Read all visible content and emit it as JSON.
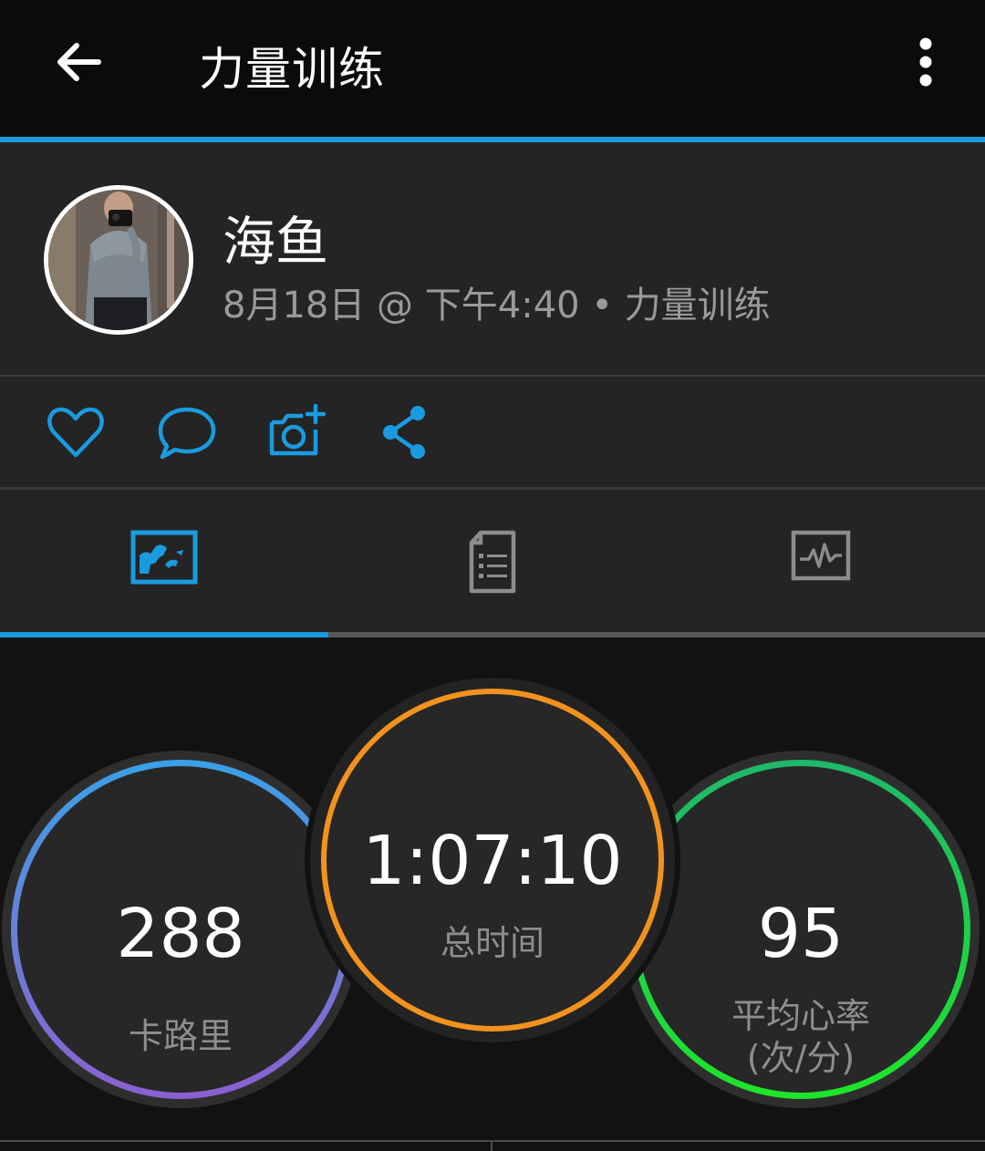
{
  "header": {
    "title": "力量训练",
    "back_icon": "arrow-left-icon",
    "menu_icon": "more-vertical-icon"
  },
  "profile": {
    "name": "海鱼",
    "meta": "8月18日 @ 下午4:40 • 力量训练"
  },
  "actions": [
    {
      "name": "like",
      "icon": "heart-icon"
    },
    {
      "name": "comment",
      "icon": "comment-icon"
    },
    {
      "name": "add-photo",
      "icon": "camera-plus-icon"
    },
    {
      "name": "share",
      "icon": "share-icon"
    }
  ],
  "tabs": [
    {
      "name": "overview",
      "icon": "overview-chart-icon",
      "active": true
    },
    {
      "name": "details",
      "icon": "list-document-icon",
      "active": false
    },
    {
      "name": "stats",
      "icon": "heart-rate-chart-icon",
      "active": false
    }
  ],
  "stats": {
    "calories": {
      "value": "288",
      "label": "卡路里"
    },
    "total_time": {
      "value": "1:07:10",
      "label": "总时间"
    },
    "avg_hr": {
      "value": "95",
      "label_line1": "平均心率",
      "label_line2": "(次/分)"
    }
  },
  "colors": {
    "accent": "#1a9be0",
    "calories_ring": [
      "#3aa0e6",
      "#8a60d0"
    ],
    "time_ring": "#f2921e",
    "hr_ring": [
      "#1fb86a",
      "#1ee52a"
    ]
  }
}
